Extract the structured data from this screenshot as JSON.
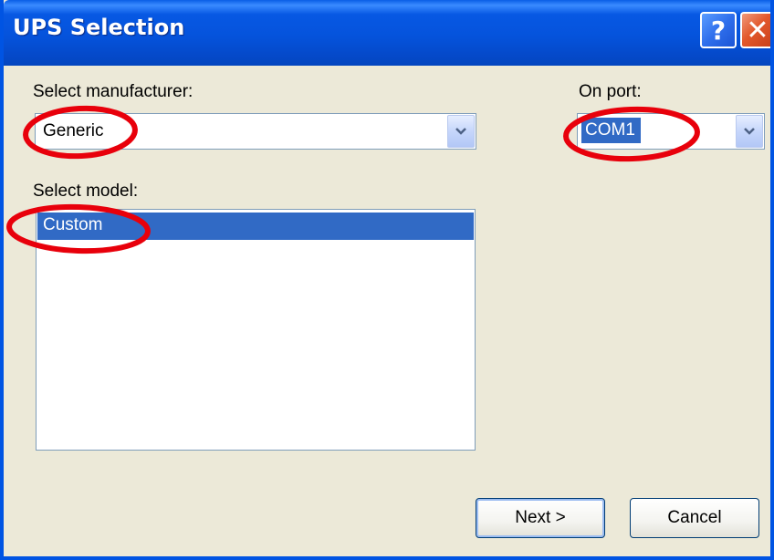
{
  "window": {
    "title": "UPS Selection",
    "help_glyph": "?",
    "close_glyph": "✕"
  },
  "manufacturer": {
    "label": "Select manufacturer:",
    "value": "Generic"
  },
  "port": {
    "label": "On port:",
    "value": "COM1"
  },
  "model": {
    "label": "Select model:",
    "items": [
      {
        "label": "Custom",
        "selected": true
      }
    ]
  },
  "buttons": {
    "next_label": "Next >",
    "cancel_label": "Cancel"
  },
  "colors": {
    "titlebar_blue": "#0553dc",
    "selection_blue": "#316ac5",
    "dialog_face": "#ece9d8",
    "annotation_red": "#e8000b"
  },
  "icons": {
    "help": "help-icon",
    "close": "close-icon",
    "dropdown": "chevron-down-icon"
  }
}
